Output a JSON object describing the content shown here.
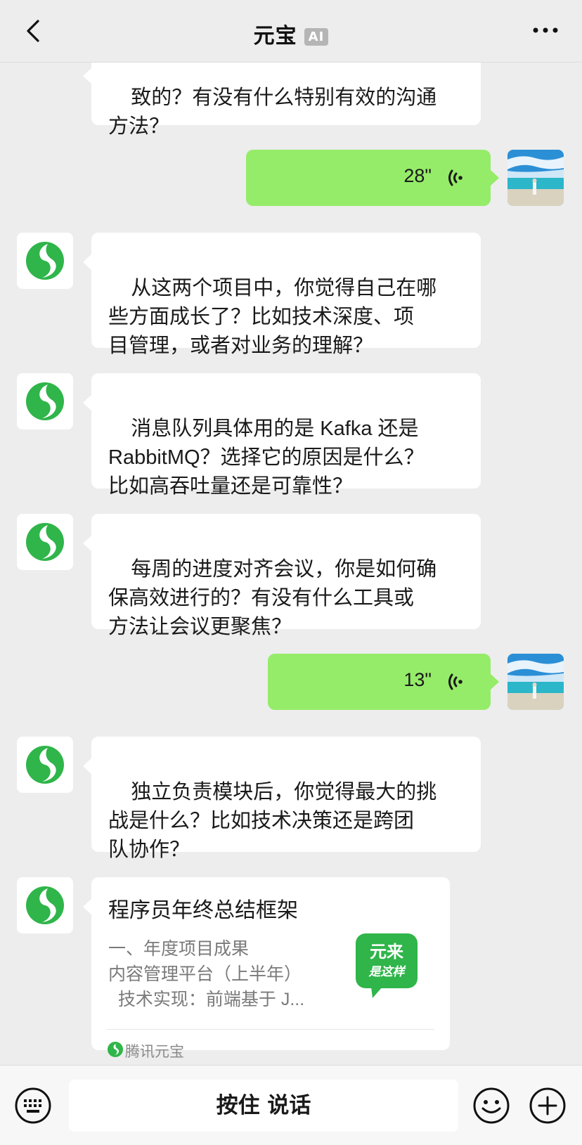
{
  "header": {
    "title": "元宝",
    "badge": "AI"
  },
  "messages": {
    "partial_top": "致的？有没有什么特别有效的沟通\n方法？",
    "voice1_duration": "28\"",
    "bot1": "从这两个项目中，你觉得自己在哪\n些方面成长了？比如技术深度、项\n目管理，或者对业务的理解？",
    "bot2": "消息队列具体用的是 Kafka 还是\nRabbitMQ？选择它的原因是什么？\n比如高吞吐量还是可靠性？",
    "bot3": "每周的进度对齐会议，你是如何确\n保高效进行的？有没有什么工具或\n方法让会议更聚焦？",
    "voice2_duration": "13\"",
    "bot4": "独立负责模块后，你觉得最大的挑\n战是什么？比如技术决策还是跨团\n队协作？"
  },
  "card": {
    "title": "程序员年终总结框架",
    "line1": "一、年度项目成果",
    "line2": "内容管理平台（上半年）",
    "line3": "  技术实现：前端基于 J...",
    "logo_line1": "元来",
    "logo_line2": "是这样",
    "source": "腾讯元宝"
  },
  "input": {
    "talk_label": "按住 说话"
  },
  "colors": {
    "background": "#ededed",
    "voice_bubble": "#95ec69",
    "brand_green": "#2fb54a"
  }
}
